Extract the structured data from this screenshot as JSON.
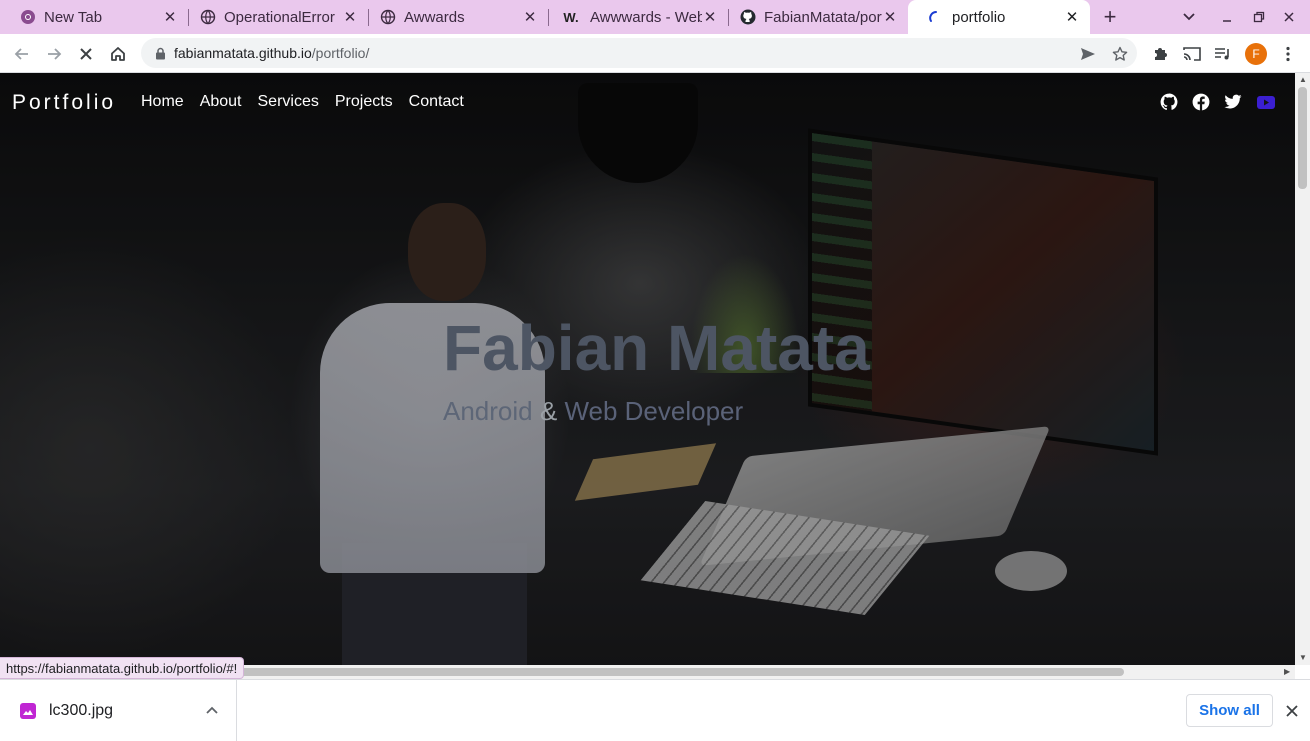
{
  "tabs": [
    {
      "title": "New Tab",
      "favicon": "chrome-icon"
    },
    {
      "title": "OperationalError",
      "favicon": "globe-icon"
    },
    {
      "title": "Awwards",
      "favicon": "globe-icon"
    },
    {
      "title": "Awwwards - Web",
      "favicon": "awwwards-w-icon",
      "favicon_text": "W."
    },
    {
      "title": "FabianMatata/portfolio",
      "favicon": "github-icon"
    },
    {
      "title": "portfolio",
      "favicon": "loading-spinner-icon",
      "active": true
    }
  ],
  "toolbar": {
    "url_host": "fabianmatata.github.io",
    "url_path": "/portfolio/",
    "avatar_letter": "F"
  },
  "page": {
    "brand": "Portfolio",
    "nav": [
      "Home",
      "About",
      "Services",
      "Projects",
      "Contact"
    ],
    "headline": "Fabian Matata",
    "subtitle_part1": "Android",
    "subtitle_amp": "&",
    "subtitle_part2": "Web Developer",
    "social_icons": [
      "github-icon",
      "facebook-icon",
      "twitter-icon",
      "youtube-icon"
    ]
  },
  "status_bar": {
    "link_url": "https://fabianmatata.github.io/portfolio/#!"
  },
  "downloads": {
    "file_name": "lc300.jpg",
    "show_all_label": "Show all"
  },
  "colors": {
    "tabstrip_bg": "#eac8ed",
    "youtube_icon": "#3b1fd1",
    "show_all_text": "#1a73e8",
    "avatar_bg": "#e8710a"
  }
}
